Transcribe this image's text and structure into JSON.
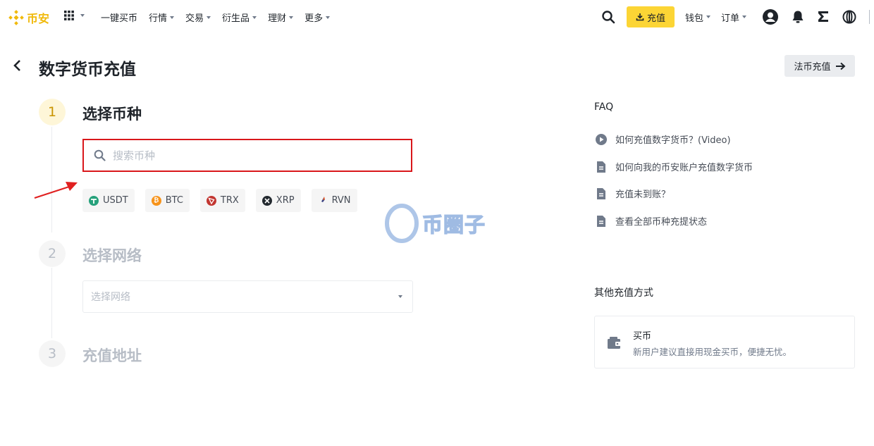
{
  "nav": {
    "logo_text": "币安",
    "links": [
      {
        "label": "一键买币",
        "caret": false
      },
      {
        "label": "行情",
        "caret": true
      },
      {
        "label": "交易",
        "caret": true
      },
      {
        "label": "衍生品",
        "caret": true
      },
      {
        "label": "理财",
        "caret": true
      },
      {
        "label": "更多",
        "caret": true
      }
    ],
    "deposit_label": "充值",
    "wallet_label": "钱包",
    "orders_label": "订单",
    "accent_color": "#fcd535",
    "brand_color": "#f0b90b"
  },
  "page": {
    "title": "数字货币充值",
    "fiat_button_label": "法币充值"
  },
  "steps": [
    {
      "number": "1",
      "title": "选择币种",
      "active": true
    },
    {
      "number": "2",
      "title": "选择网络",
      "active": false
    },
    {
      "number": "3",
      "title": "充值地址",
      "active": false
    }
  ],
  "search": {
    "placeholder": "搜索币种",
    "value": ""
  },
  "coins": [
    {
      "symbol": "USDT",
      "color": "#26a17b",
      "icon": "tether-icon"
    },
    {
      "symbol": "BTC",
      "color": "#f7931a",
      "icon": "bitcoin-icon"
    },
    {
      "symbol": "TRX",
      "color": "#c23631",
      "icon": "tron-icon"
    },
    {
      "symbol": "XRP",
      "color": "#23292f",
      "icon": "xrp-icon"
    },
    {
      "symbol": "RVN",
      "color": "#384182",
      "icon": "ravencoin-icon"
    }
  ],
  "network": {
    "placeholder": "选择网络"
  },
  "faq": {
    "title": "FAQ",
    "items": [
      {
        "label": "如何充值数字货币？(Video)",
        "icon": "play-icon"
      },
      {
        "label": "如何向我的币安账户充值数字货币",
        "icon": "document-icon"
      },
      {
        "label": "充值未到账？",
        "icon": "document-icon"
      },
      {
        "label": "查看全部币种充提状态",
        "icon": "document-icon"
      }
    ]
  },
  "other_methods": {
    "title": "其他充值方式",
    "card_title": "买币",
    "card_desc": "新用户建议直接用现金买币，便捷无忧。"
  },
  "watermark": {
    "text": "币圈子"
  }
}
